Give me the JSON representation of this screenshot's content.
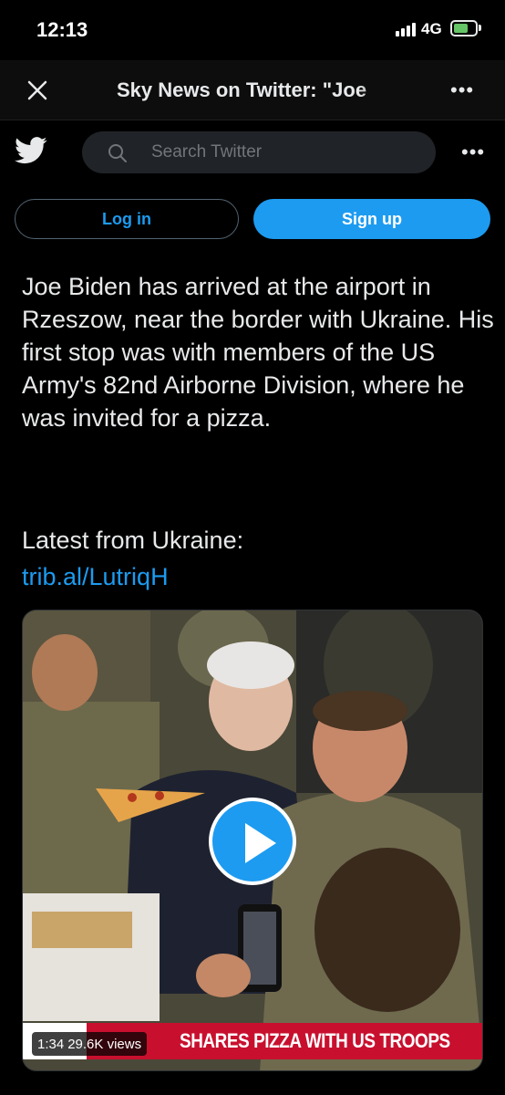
{
  "status_bar": {
    "time": "12:13",
    "network": "4G"
  },
  "browser": {
    "title": "Sky News on Twitter: \"Joe",
    "close_icon": "close-icon",
    "more_icon": "more-horizontal-icon"
  },
  "twitter_header": {
    "logo_icon": "twitter-bird-icon",
    "search_placeholder": "Search Twitter",
    "login_label": "Log in",
    "signup_label": "Sign up"
  },
  "tweet": {
    "text": "Joe Biden has arrived at the airport in Rzeszow, near the border with Ukraine. His first stop was with members of the US Army's 82nd Airborne Division, where he was invited for a pizza.",
    "latest_label": "Latest from Ukraine:",
    "link": "trib.al/LutriqH"
  },
  "media": {
    "duration": "1:34",
    "views": "29.6K views",
    "headline": "SHARES PIZZA WITH US TROOPS",
    "play_icon": "play-icon"
  },
  "colors": {
    "accent": "#1d9bf0",
    "background": "#000000",
    "banner_red": "#c8102e"
  }
}
